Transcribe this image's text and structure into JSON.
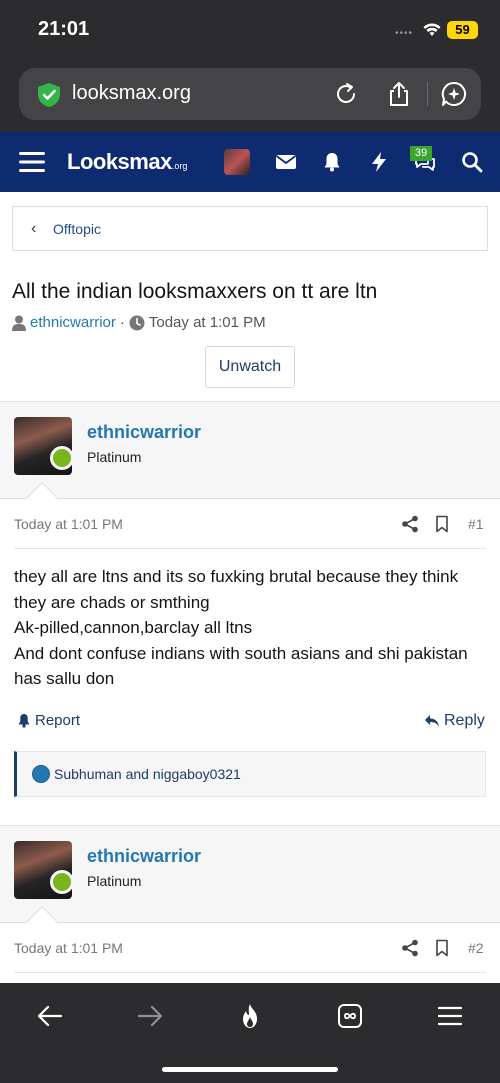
{
  "status": {
    "time": "21:01",
    "signal": "••••",
    "battery": "59"
  },
  "browser": {
    "url": "looksmax.org"
  },
  "site": {
    "logo_main": "Looksmax",
    "logo_suffix": ".org",
    "inbox_badge": "39"
  },
  "breadcrumb": {
    "label": "Offtopic"
  },
  "thread": {
    "title": "All the indian looksmaxxers on tt are ltn",
    "author": "ethnicwarrior",
    "separator": "·",
    "time": "Today at 1:01 PM",
    "unwatch_label": "Unwatch"
  },
  "posts": [
    {
      "author": "ethnicwarrior",
      "rank": "Platinum",
      "time": "Today at 1:01 PM",
      "number": "#1",
      "lines": [
        "they all are ltns and its so fuxking brutal because they think they are chads or smthing",
        "Ak-pilled,cannon,barclay all ltns",
        "And dont confuse indians with south asians and shi pakistan has sallu don"
      ],
      "report_label": "Report",
      "reply_label": "Reply",
      "reactions": "Subhuman and niggaboy0321"
    },
    {
      "author": "ethnicwarrior",
      "rank": "Platinum",
      "time": "Today at 1:01 PM",
      "number": "#2"
    }
  ],
  "colors": {
    "nav_bg": "#0e2a70",
    "link": "#2577b1",
    "online_dot": "#7ab51d",
    "badge": "#3aa52f",
    "battery": "#ffd60a"
  }
}
